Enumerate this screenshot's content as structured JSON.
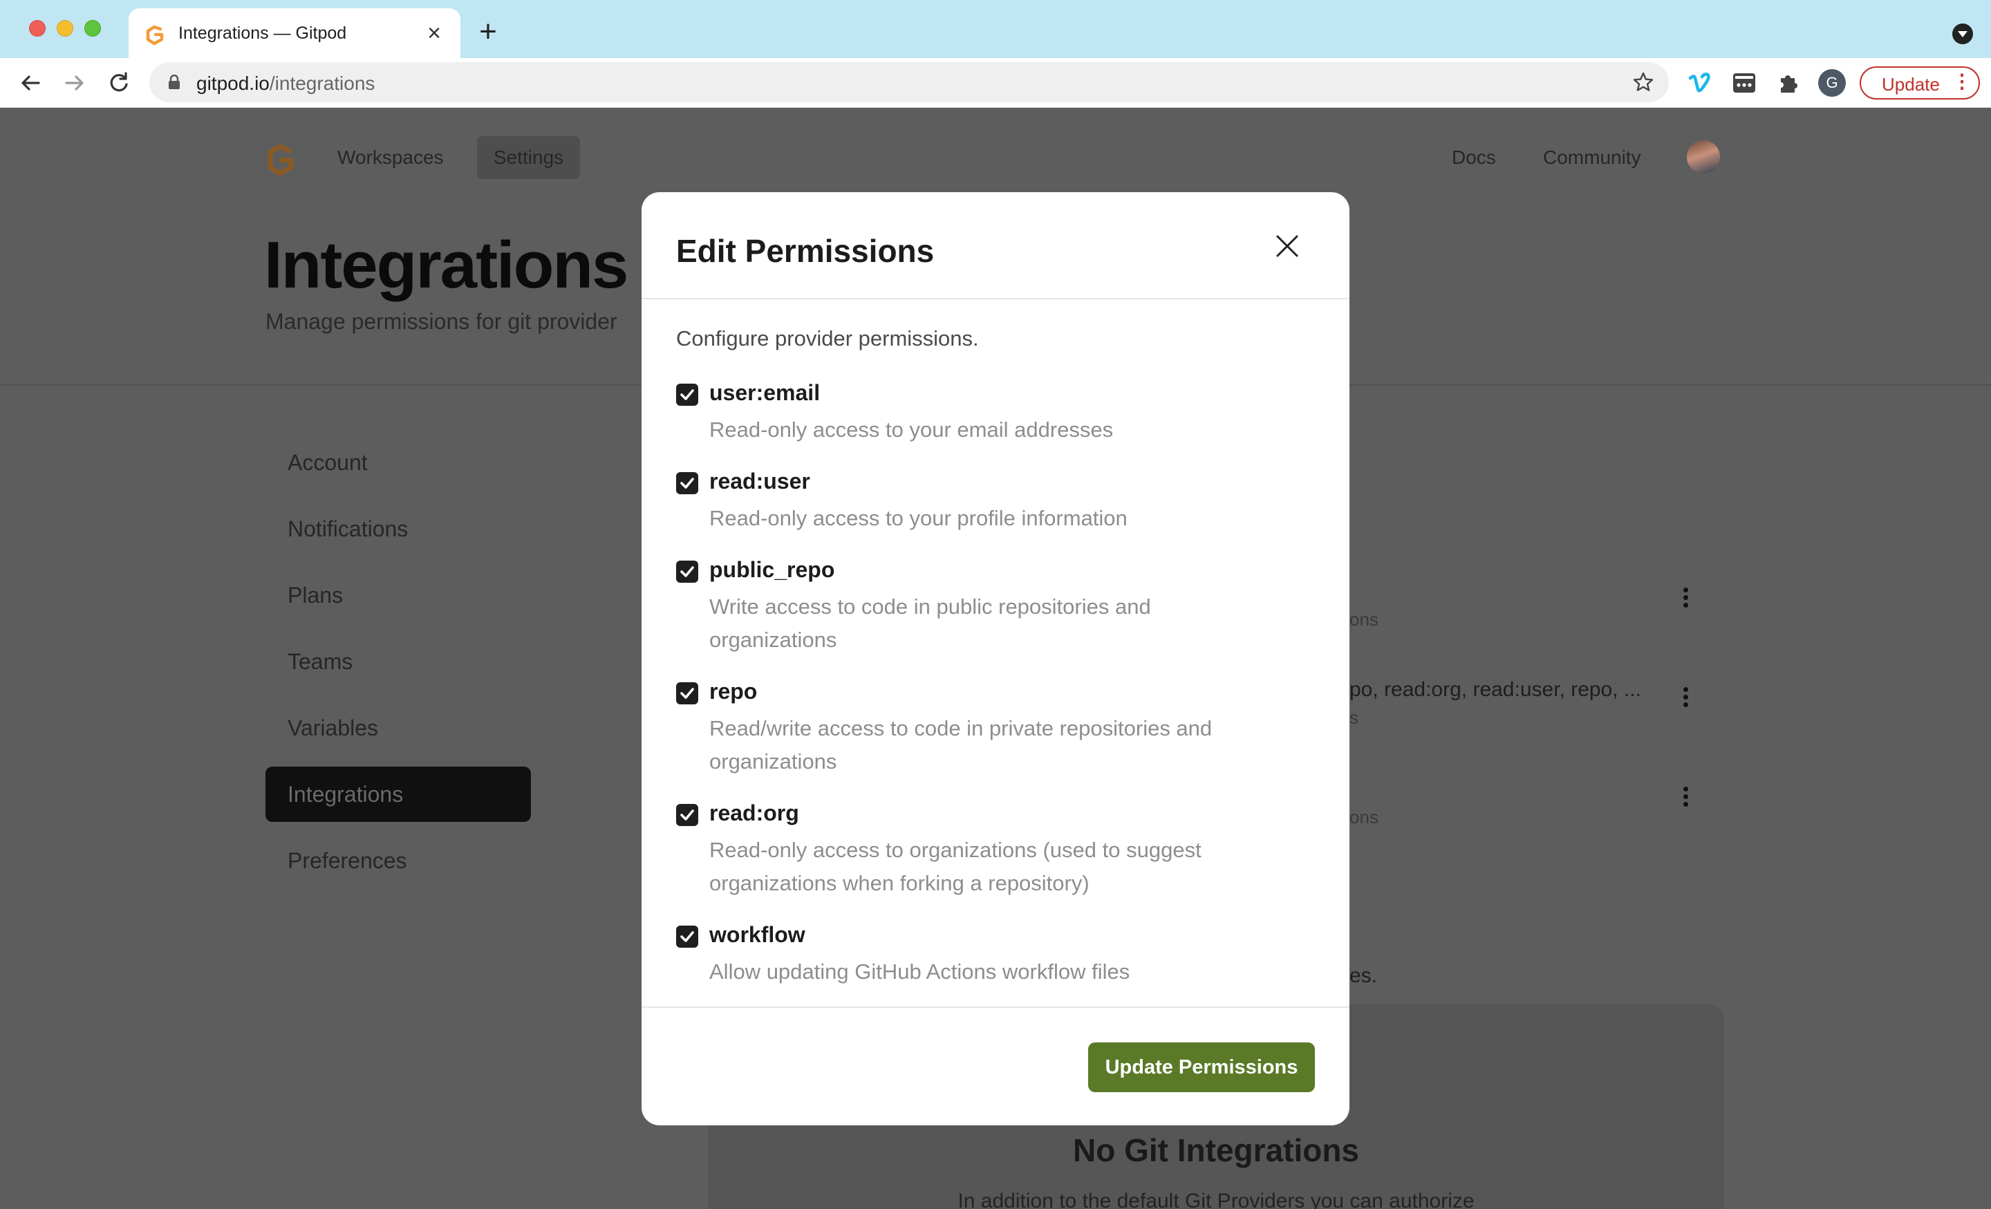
{
  "browser": {
    "tab_title": "Integrations — Gitpod",
    "url_host": "gitpod.io",
    "url_path": "/integrations",
    "profile_initial": "G",
    "update_label": "Update"
  },
  "header": {
    "nav": [
      "Workspaces",
      "Settings"
    ],
    "links": [
      "Docs",
      "Community"
    ]
  },
  "page": {
    "title": "Integrations",
    "subtitle": "Manage permissions for git provider"
  },
  "sidebar": {
    "items": [
      {
        "label": "Account"
      },
      {
        "label": "Notifications"
      },
      {
        "label": "Plans"
      },
      {
        "label": "Teams"
      },
      {
        "label": "Variables"
      },
      {
        "label": "Integrations"
      },
      {
        "label": "Preferences"
      }
    ],
    "active": "Integrations"
  },
  "background_list": {
    "row1_sub": "ons",
    "row2_text": "po, read:org, read:user, repo, ...",
    "row2_sub": "s",
    "row3_sub": "ons",
    "note_tail": "es."
  },
  "empty_state": {
    "title": "No Git Integrations",
    "text": "In addition to the default Git Providers you can authorize"
  },
  "modal": {
    "title": "Edit Permissions",
    "description": "Configure provider permissions.",
    "permissions": [
      {
        "name": "user:email",
        "description": "Read-only access to your email addresses",
        "checked": true
      },
      {
        "name": "read:user",
        "description": "Read-only access to your profile information",
        "checked": true
      },
      {
        "name": "public_repo",
        "description": "Write access to code in public repositories and organizations",
        "checked": true
      },
      {
        "name": "repo",
        "description": "Read/write access to code in private repositories and organizations",
        "checked": true
      },
      {
        "name": "read:org",
        "description": "Read-only access to organizations (used to suggest organizations when forking a repository)",
        "checked": true
      },
      {
        "name": "workflow",
        "description": "Allow updating GitHub Actions workflow files",
        "checked": true
      }
    ],
    "submit_label": "Update Permissions"
  },
  "colors": {
    "accent_button": "#5a7a28",
    "overlay": "#5d5d5d",
    "tabbar": "#bfe6f2",
    "logo_orange": "#f29c38"
  }
}
